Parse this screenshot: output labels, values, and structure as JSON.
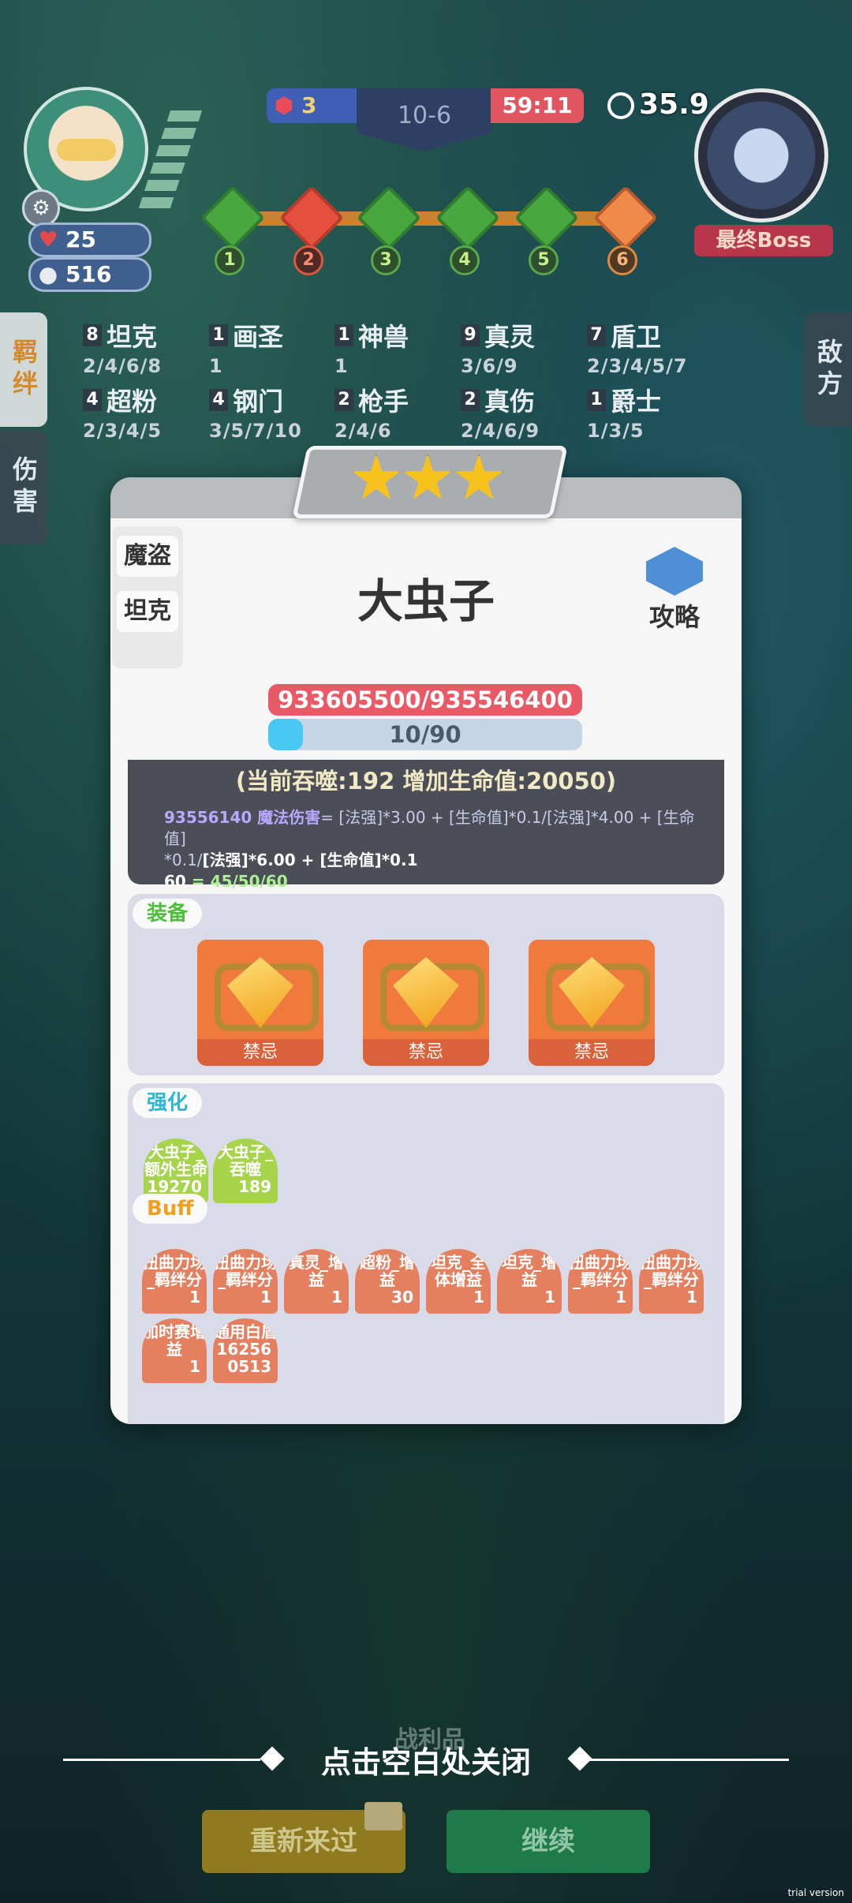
{
  "hud": {
    "hp": "25",
    "gold": "516",
    "blue_score": "3",
    "round": "10-6",
    "red_timer": "59:11",
    "countdown": "35.9",
    "boss_label": "最终Boss",
    "stages": [
      "1",
      "2",
      "3",
      "4",
      "5",
      "6"
    ]
  },
  "side_tabs": {
    "bond": "羁绊",
    "damage": "伤害",
    "enemy": "敌方"
  },
  "traits": [
    {
      "count": "8",
      "name": "坦克",
      "levels": "2/4/6/8"
    },
    {
      "count": "1",
      "name": "画圣",
      "levels": "1"
    },
    {
      "count": "1",
      "name": "神兽",
      "levels": "1"
    },
    {
      "count": "9",
      "name": "真灵",
      "levels": "3/6/9"
    },
    {
      "count": "7",
      "name": "盾卫",
      "levels": "2/3/4/5/7"
    },
    {
      "count": "4",
      "name": "超粉",
      "levels": "2/3/4/5"
    },
    {
      "count": "4",
      "name": "钢门",
      "levels": "3/5/7/10"
    },
    {
      "count": "2",
      "name": "枪手",
      "levels": "2/4/6"
    },
    {
      "count": "2",
      "name": "真伤",
      "levels": "2/4/6/9"
    },
    {
      "count": "1",
      "name": "爵士",
      "levels": "1/3/5"
    }
  ],
  "modal": {
    "jobs": [
      "魔盗",
      "坦克"
    ],
    "unit_name": "大虫子",
    "guide_label": "攻略",
    "hp_text": "933605500/935546400",
    "exp_text": "10/90",
    "exp_fraction": 0.111,
    "absorb_text": "(当前吞噬:192 增加生命值:20050)",
    "formula_dmg": "93556140 魔法伤害",
    "formula_a": "= [法强]*3.00 + [生命值]*0.1/[法强]*4.00 + [生命值]",
    "formula_b": "*0.1/",
    "formula_c": "[法强]*6.00 + [生命值]*0.1",
    "formula_d": "60",
    "formula_e": " = 45/50/60",
    "equip_tag": "装备",
    "equip_items": [
      "禁忌",
      "禁忌",
      "禁忌"
    ],
    "enh_tag": "强化",
    "enh_items": [
      {
        "name": "大虫子_额外生命",
        "value": "19270"
      },
      {
        "name": "大虫子_吞噬",
        "value": "189"
      }
    ],
    "buff_tag": "Buff",
    "buff_items": [
      {
        "name": "扭曲力场_羁绊分",
        "value": "1"
      },
      {
        "name": "扭曲力场_羁绊分",
        "value": "1"
      },
      {
        "name": "真灵_增益",
        "value": "1"
      },
      {
        "name": "超粉_增益",
        "value": "30"
      },
      {
        "name": "坦克_全体增益",
        "value": "1"
      },
      {
        "name": "坦克_增益",
        "value": "1"
      },
      {
        "name": "扭曲力场_羁绊分",
        "value": "1"
      },
      {
        "name": "扭曲力场_羁绊分",
        "value": "1"
      },
      {
        "name": "加时赛增益",
        "value": "1"
      },
      {
        "name": "通用白盾",
        "value": "16256 0513"
      }
    ]
  },
  "bottom": {
    "loot_ghost": "战利品",
    "close_hint": "点击空白处关闭",
    "retry": "重新来过",
    "continue": "继续",
    "trial": "trial version"
  }
}
